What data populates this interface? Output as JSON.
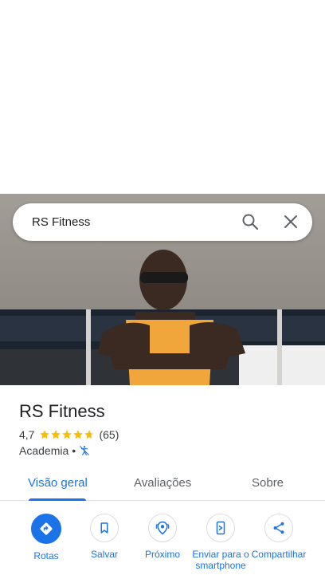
{
  "search": {
    "query": "RS Fitness"
  },
  "place": {
    "name": "RS Fitness",
    "rating": "4,7",
    "reviews_count": "(65)",
    "stars": 4.7,
    "category": "Academia",
    "separator": "•"
  },
  "tabs": [
    {
      "label": "Visão geral",
      "active": true
    },
    {
      "label": "Avaliações",
      "active": false
    },
    {
      "label": "Sobre",
      "active": false
    }
  ],
  "actions": [
    {
      "label": "Rotas",
      "icon": "directions-icon"
    },
    {
      "label": "Salvar",
      "icon": "bookmark-icon"
    },
    {
      "label": "Próximo",
      "icon": "nearby-icon"
    },
    {
      "label": "Enviar para o smartphone",
      "icon": "send-to-phone-icon"
    },
    {
      "label": "Compartilhar",
      "icon": "share-icon"
    }
  ],
  "colors": {
    "accent": "#1a73e8",
    "star": "#fbbc04"
  }
}
